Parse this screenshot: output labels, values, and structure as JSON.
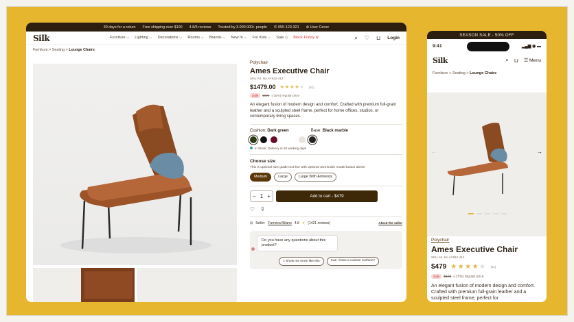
{
  "desktop": {
    "topbar": [
      "30 days for a return",
      "Free shipping over $100",
      "4.8/5 reviews",
      "Trusted by 3.000.000+ people",
      "055-123-321",
      "User Cener"
    ],
    "logo": "Silk",
    "nav": [
      "Furniture",
      "Lighting",
      "Decorations",
      "Rooms",
      "Brands",
      "New In",
      "For Kids",
      "Sale",
      "Black Friday"
    ],
    "login": "Login",
    "breadcrumb": {
      "a": "Furniture",
      "b": "Seating",
      "c": "Lounge Chairs"
    },
    "product": {
      "brand": "Polychair",
      "title": "Ames Executive Chair",
      "sku": "SKU Art. No AY812-412",
      "price": "$1479.00",
      "rating_count": "(41)",
      "sale_badge": "Sale",
      "old_price": "$525",
      "discount": "(-15%) regular price",
      "description": "An elegant fusion of modern design and comfort. Crafted with premium full-grain leather and a sculpted steel frame. perfect for home offices, studios, or contemporary living spaces.",
      "cushion_label": "Cushion:",
      "cushion_value": "Dark green",
      "base_label": "Base:",
      "base_value": "Black marble",
      "stock": "In Stock, Delivery in 10 working days",
      "size_title": "Choose size",
      "size_sub": "This is optional size guide text line with optional SizeGuide modal button above",
      "sizes": [
        "Medium",
        "Large",
        "Large With Armrests"
      ],
      "qty": "1",
      "cart": "Add to cart - $479",
      "seller_label": "Seller:",
      "seller_name": "Furnova Milano",
      "seller_rating": "4.8",
      "seller_reviews": "(1421 reviews)",
      "about_seller": "About the seller",
      "question": "Do you have any questions about this product?",
      "q1": "Show me more like this",
      "q2": "Can I have a custom cushion?"
    },
    "colors": {
      "swatch1": "#2c3a12",
      "swatch2": "#111111",
      "swatch3": "#6a0a2a"
    }
  },
  "mobile": {
    "sale": "SEASON SALE - 50% OFF",
    "time": "9:41",
    "logo": "Silk",
    "menu": "Menu",
    "breadcrumb": {
      "a": "Furniture",
      "b": "Seating",
      "c": "Lounge Chairs"
    },
    "brand": "Polychair",
    "title": "Ames Executive Chair",
    "sku": "SKU Art. No AY812-412",
    "price": "$479",
    "rating_count": "(41)",
    "sale_badge": "Sale",
    "old_price": "$525",
    "discount": "(-15%) regular price",
    "description": "An elegant fusion of modern design and comfort. Crafted with premium full-grain leather and a sculpted steel frame, perfect for"
  }
}
